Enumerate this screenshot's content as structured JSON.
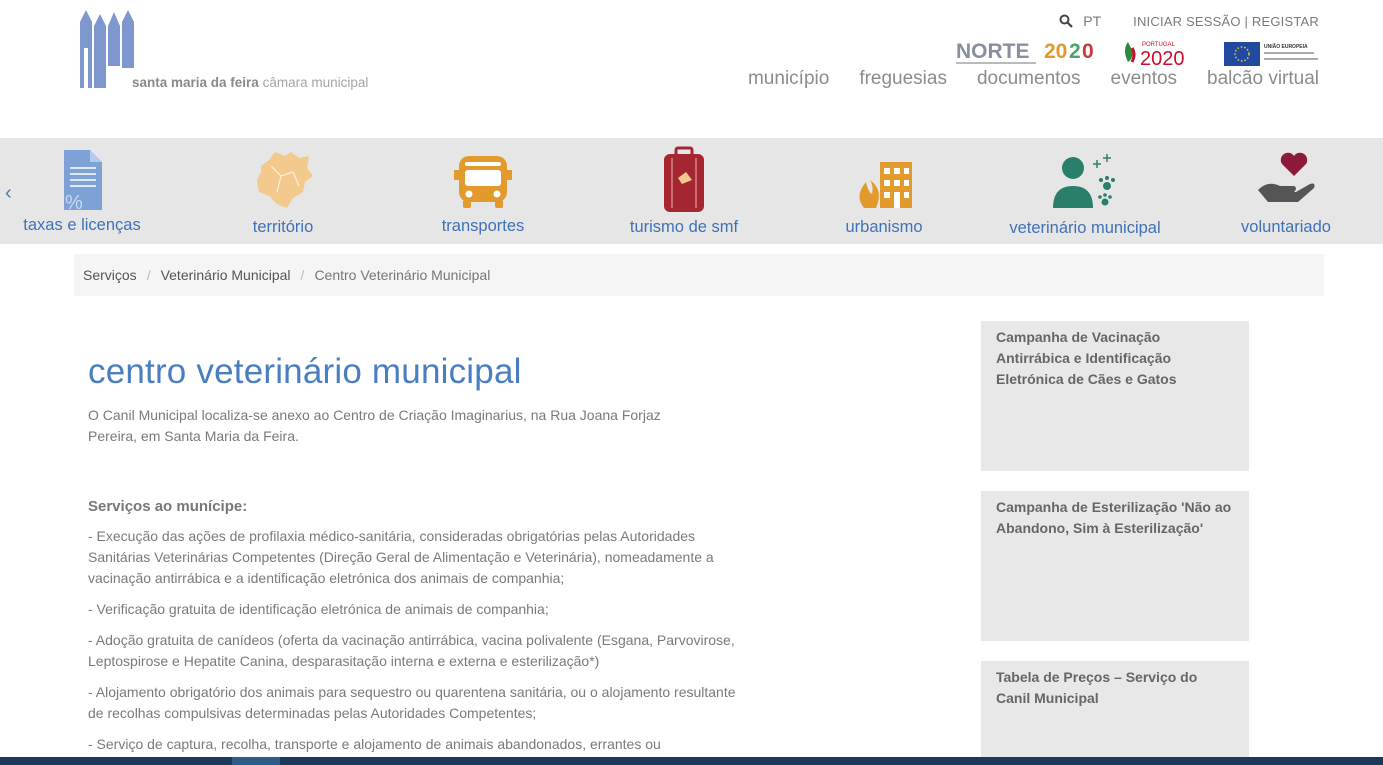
{
  "header": {
    "logo_name": "santa maria da feira",
    "logo_sub": "câmara municipal",
    "language": "PT",
    "login_label": "INICIAR SESSÃO | REGISTAR",
    "funding_logos": [
      "NORTE2020",
      "PORTUGAL 2020",
      "UNIÃO EUROPEIA"
    ],
    "nav": [
      "município",
      "freguesias",
      "documentos",
      "eventos",
      "balcão virtual"
    ]
  },
  "services": [
    {
      "label": "taxas e licenças",
      "icon": "document-percent-icon",
      "color": "#7ea2d6"
    },
    {
      "label": "território",
      "icon": "map-icon",
      "color": "#f3c98d"
    },
    {
      "label": "transportes",
      "icon": "bus-icon",
      "color": "#e39a2d"
    },
    {
      "label": "turismo de smf",
      "icon": "suitcase-icon",
      "color": "#a52630"
    },
    {
      "label": "urbanismo",
      "icon": "building-icon",
      "color": "#e39a2d"
    },
    {
      "label": "veterinário municipal",
      "icon": "person-paw-icon",
      "color": "#2a7f6b"
    },
    {
      "label": "voluntariado",
      "icon": "heart-hand-icon",
      "color": "#8d1a3a"
    }
  ],
  "breadcrumb": [
    "Serviços",
    "Veterinário Municipal",
    "Centro Veterinário Municipal"
  ],
  "page": {
    "title": "centro veterinário municipal",
    "intro": "O Canil Municipal localiza-se anexo ao Centro de Criação Imaginarius, na Rua Joana Forjaz Pereira, em Santa Maria da Feira.",
    "section_heading": "Serviços ao munícipe:",
    "items": [
      "- Execução das ações de profilaxia médico-sanitária, consideradas obrigatórias pelas Autoridades Sanitárias Veterinárias Competentes (Direção Geral de Alimentação e Veterinária), nomeadamente a vacinação antirrábica e a identificação eletrónica dos animais de companhia;",
      "- Verificação gratuita de identificação eletrónica de animais de companhia;",
      "- Adoção gratuita de canídeos (oferta da vacinação antirrábica, vacina polivalente (Esgana, Parvovirose, Leptospirose e Hepatite Canina, desparasitação interna e externa e esterilização*)",
      "- Alojamento obrigatório dos animais para sequestro ou quarentena sanitária, ou o alojamento resultante de recolhas compulsivas determinadas pelas Autoridades Competentes;",
      "- Serviço de captura, recolha, transporte e alojamento de animais abandonados, errantes ou"
    ]
  },
  "sidebar": [
    "Campanha de Vacinação Antirrábica e Identificação Eletrónica de Cães e Gatos",
    "Campanha de Esterilização 'Não ao Abandono, Sim à Esterilização'",
    "Tabela de Preços – Serviço do Canil Municipal"
  ]
}
